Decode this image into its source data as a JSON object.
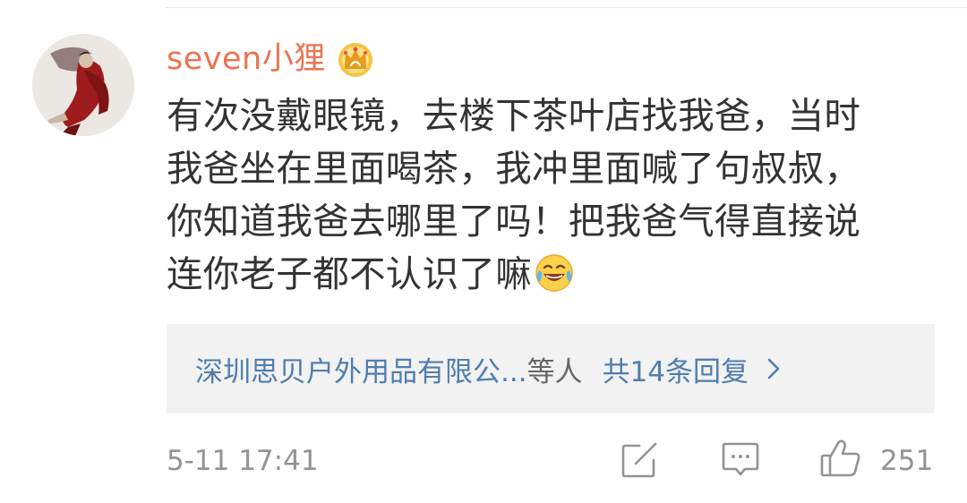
{
  "comment": {
    "username": "seven小狸",
    "user_badge_icon": "crown-icon",
    "text": "有次没戴眼镜，去楼下茶叶店找我爸，当时\n我爸坐在里面喝茶，我冲里面喊了句叔叔，\n你知道我爸去哪里了吗！把我爸气得直接说\n连你老子都不认识了嘛",
    "text_emoji": "laughing-tears-emoji",
    "replies": {
      "names": "深圳思贝户外用品有限公...",
      "names_suffix": "等人",
      "count_label": "共14条回复"
    },
    "timestamp": "5-11 17:41",
    "like_count": "251"
  },
  "colors": {
    "username": "#eb7350",
    "link_blue": "#507daf",
    "meta_gray": "#939393",
    "reply_bg": "#f2f2f2"
  }
}
